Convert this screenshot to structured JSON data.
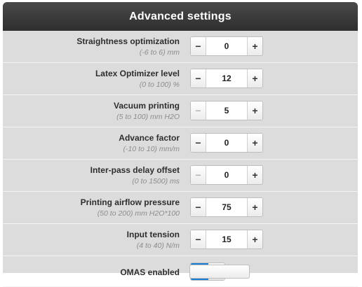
{
  "window": {
    "title": "Advanced settings"
  },
  "settings": [
    {
      "name": "Straightness optimization",
      "range": "(-6 to 6) mm",
      "value": "0"
    },
    {
      "name": "Latex Optimizer level",
      "range": "(0 to 100) %",
      "value": "12"
    },
    {
      "name": "Vacuum printing",
      "range": "(5 to 100) mm H2O",
      "value": "5"
    },
    {
      "name": "Advance factor",
      "range": "(-10 to 10) mm/m",
      "value": "0"
    },
    {
      "name": "Inter-pass delay offset",
      "range": "(0 to 1500) ms",
      "value": "0"
    },
    {
      "name": "Printing airflow pressure",
      "range": "(50 to 200) mm H2O*100",
      "value": "75"
    },
    {
      "name": "Input tension",
      "range": "(4 to 40) N/m",
      "value": "15"
    }
  ],
  "stepper": {
    "minus": "−",
    "plus": "+"
  },
  "omas": {
    "label": "OMAS enabled",
    "state": "on"
  },
  "colors": {
    "titlebar": "#333333",
    "panel": "#dcdcdc",
    "toggle_on": "#1a7fd0"
  }
}
